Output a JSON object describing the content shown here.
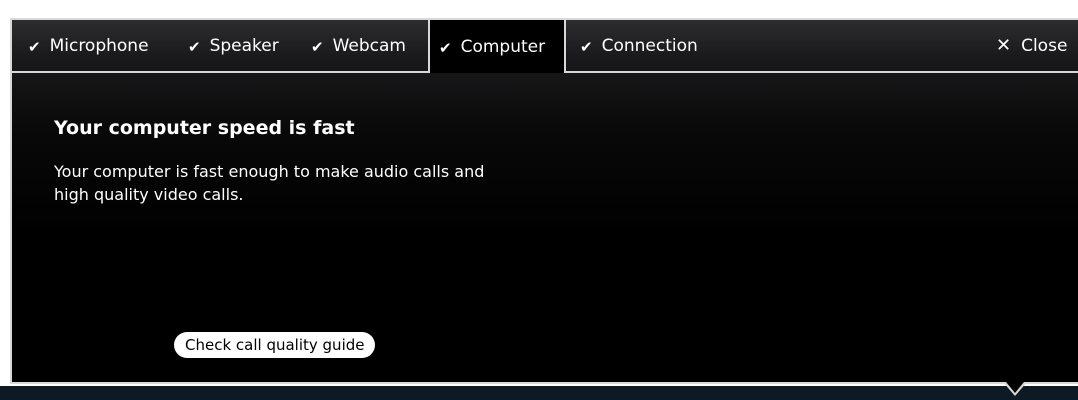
{
  "tabs": {
    "microphone": "Microphone",
    "speaker": "Speaker",
    "webcam": "Webcam",
    "computer": "Computer",
    "connection": "Connection"
  },
  "icons": {
    "check": "✔",
    "close": "✕"
  },
  "close_label": "Close",
  "content": {
    "title": "Your computer speed is fast",
    "description": "Your computer is fast enough to make audio calls and high quality video calls."
  },
  "guide_button_label": "Check call quality guide",
  "colors": {
    "background": "#000000",
    "border": "#d8d8d8",
    "text": "#ffffff"
  }
}
